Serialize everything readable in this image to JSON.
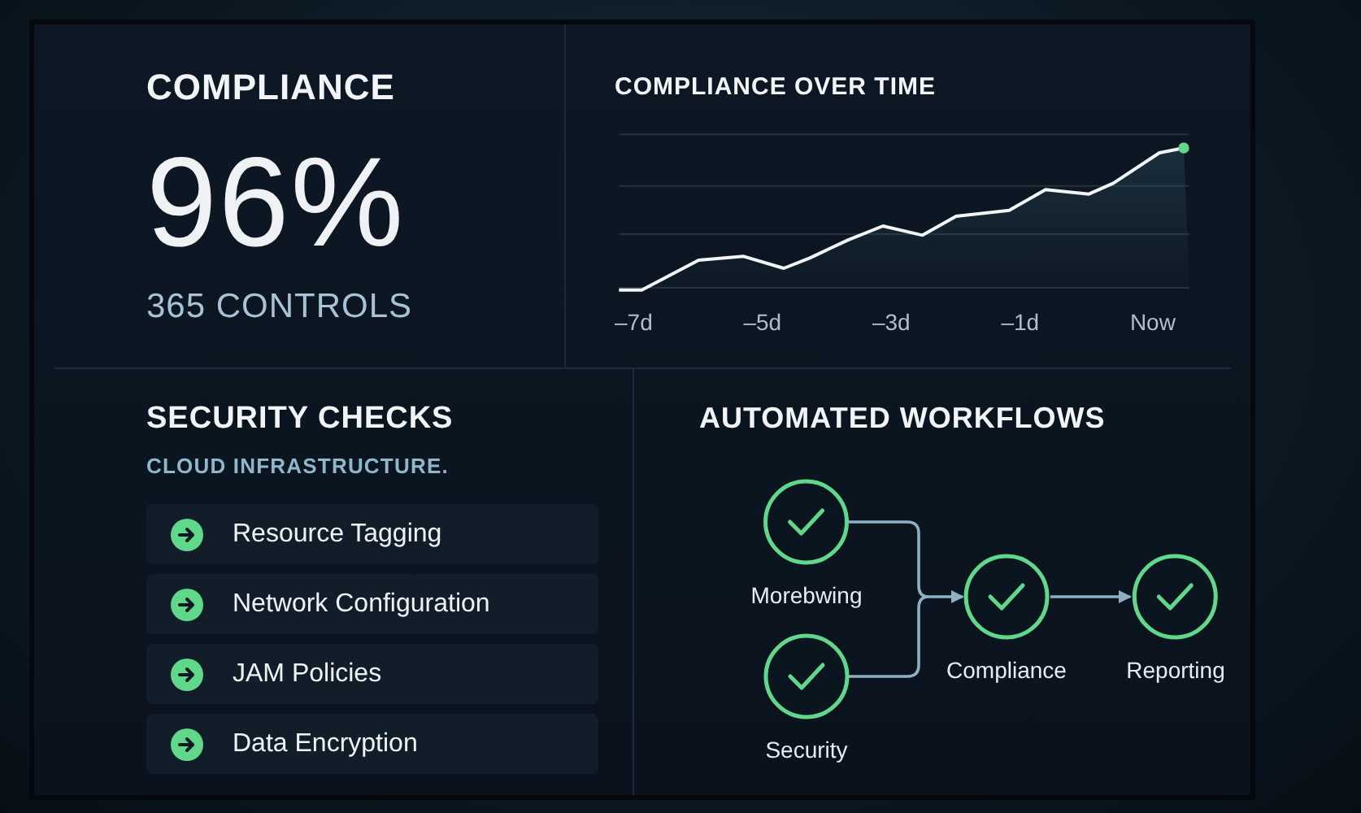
{
  "compliance": {
    "title": "COMPLIANCE",
    "value": "96%",
    "subtitle": "365 CONTROLS"
  },
  "trend": {
    "title": "COMPLIANCE OVER TIME",
    "x_labels": [
      "–7d",
      "–5d",
      "–3d",
      "–1d",
      "Now"
    ]
  },
  "security_checks": {
    "title": "SECURITY CHECKS",
    "subtitle": "CLOUD INFRASTRUCTURE.",
    "items": [
      {
        "label": "Resource Tagging"
      },
      {
        "label": "Network Configuration"
      },
      {
        "label": "JAM Policies"
      },
      {
        "label": "Data Encryption"
      }
    ]
  },
  "workflows": {
    "title": "AUTOMATED WORKFLOWS",
    "nodes": [
      {
        "label": "Morebwing"
      },
      {
        "label": "Security"
      },
      {
        "label": "Compliance"
      },
      {
        "label": "Reporting"
      }
    ]
  }
}
